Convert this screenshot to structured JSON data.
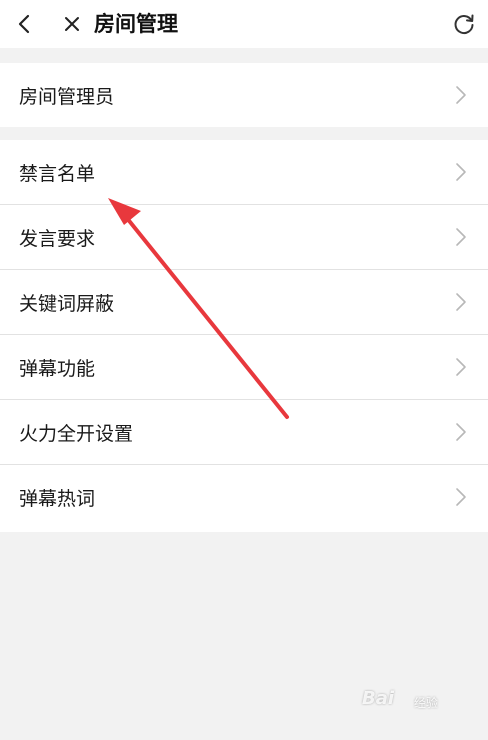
{
  "header": {
    "title": "房间管理",
    "back_icon": "chevron-left-icon",
    "close_icon": "close-icon",
    "refresh_icon": "refresh-icon"
  },
  "groups": [
    {
      "items": [
        {
          "label": "房间管理员",
          "icon": "chevron-right-icon"
        }
      ]
    },
    {
      "items": [
        {
          "label": "禁言名单",
          "icon": "chevron-right-icon"
        },
        {
          "label": "发言要求",
          "icon": "chevron-right-icon"
        },
        {
          "label": "关键词屏蔽",
          "icon": "chevron-right-icon"
        },
        {
          "label": "弹幕功能",
          "icon": "chevron-right-icon"
        },
        {
          "label": "火力全开设置",
          "icon": "chevron-right-icon"
        },
        {
          "label": "弹幕热词",
          "icon": "chevron-right-icon"
        }
      ]
    }
  ],
  "annotation": {
    "color": "#e8383d"
  },
  "watermark": {
    "brand": "Bai",
    "sub": "经验"
  },
  "colors": {
    "background": "#f2f2f2",
    "panel": "#ffffff",
    "chevron": "#b8b8b8"
  }
}
